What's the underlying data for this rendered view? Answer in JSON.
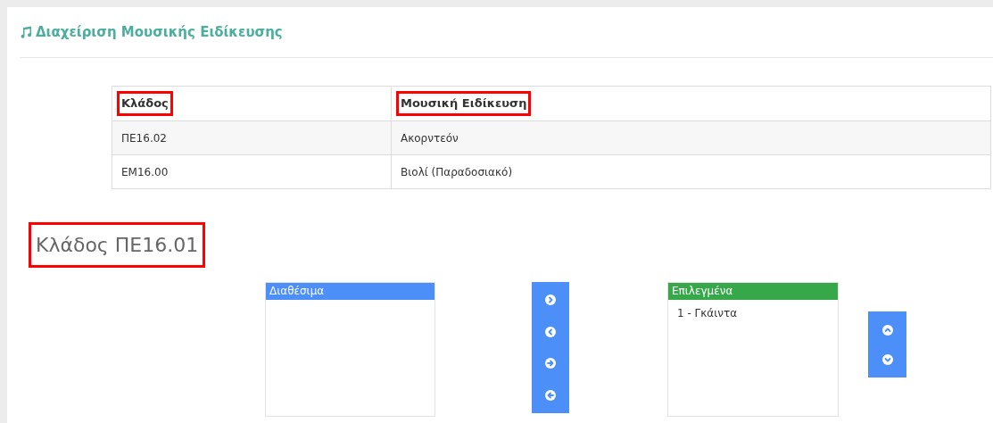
{
  "page_title": "Διαχείριση Μουσικής Ειδίκευσης",
  "table": {
    "columns": [
      {
        "label": "Κλάδος",
        "highlighted": true
      },
      {
        "label": "Μουσική Ειδίκευση",
        "highlighted": true
      }
    ],
    "rows": [
      [
        "ΠΕ16.02",
        "Ακορντεόν"
      ],
      [
        "ΕΜ16.00",
        "Βιολί (Παραδοσιακό)"
      ]
    ]
  },
  "section_heading": {
    "text": "Κλάδος ΠΕ16.01",
    "highlighted": true
  },
  "available_list": {
    "title": "Διαθέσιμα"
  },
  "transfer_buttons": [
    {
      "kind": "chevron-right"
    },
    {
      "kind": "chevron-left"
    },
    {
      "kind": "arrow-right"
    },
    {
      "kind": "arrow-left"
    }
  ],
  "selected_list": {
    "title": "Επιλεγμένα",
    "items": [
      "1 - Γκάιντα"
    ]
  },
  "order_buttons": [
    {
      "kind": "chevron-up"
    },
    {
      "kind": "chevron-down"
    }
  ]
}
